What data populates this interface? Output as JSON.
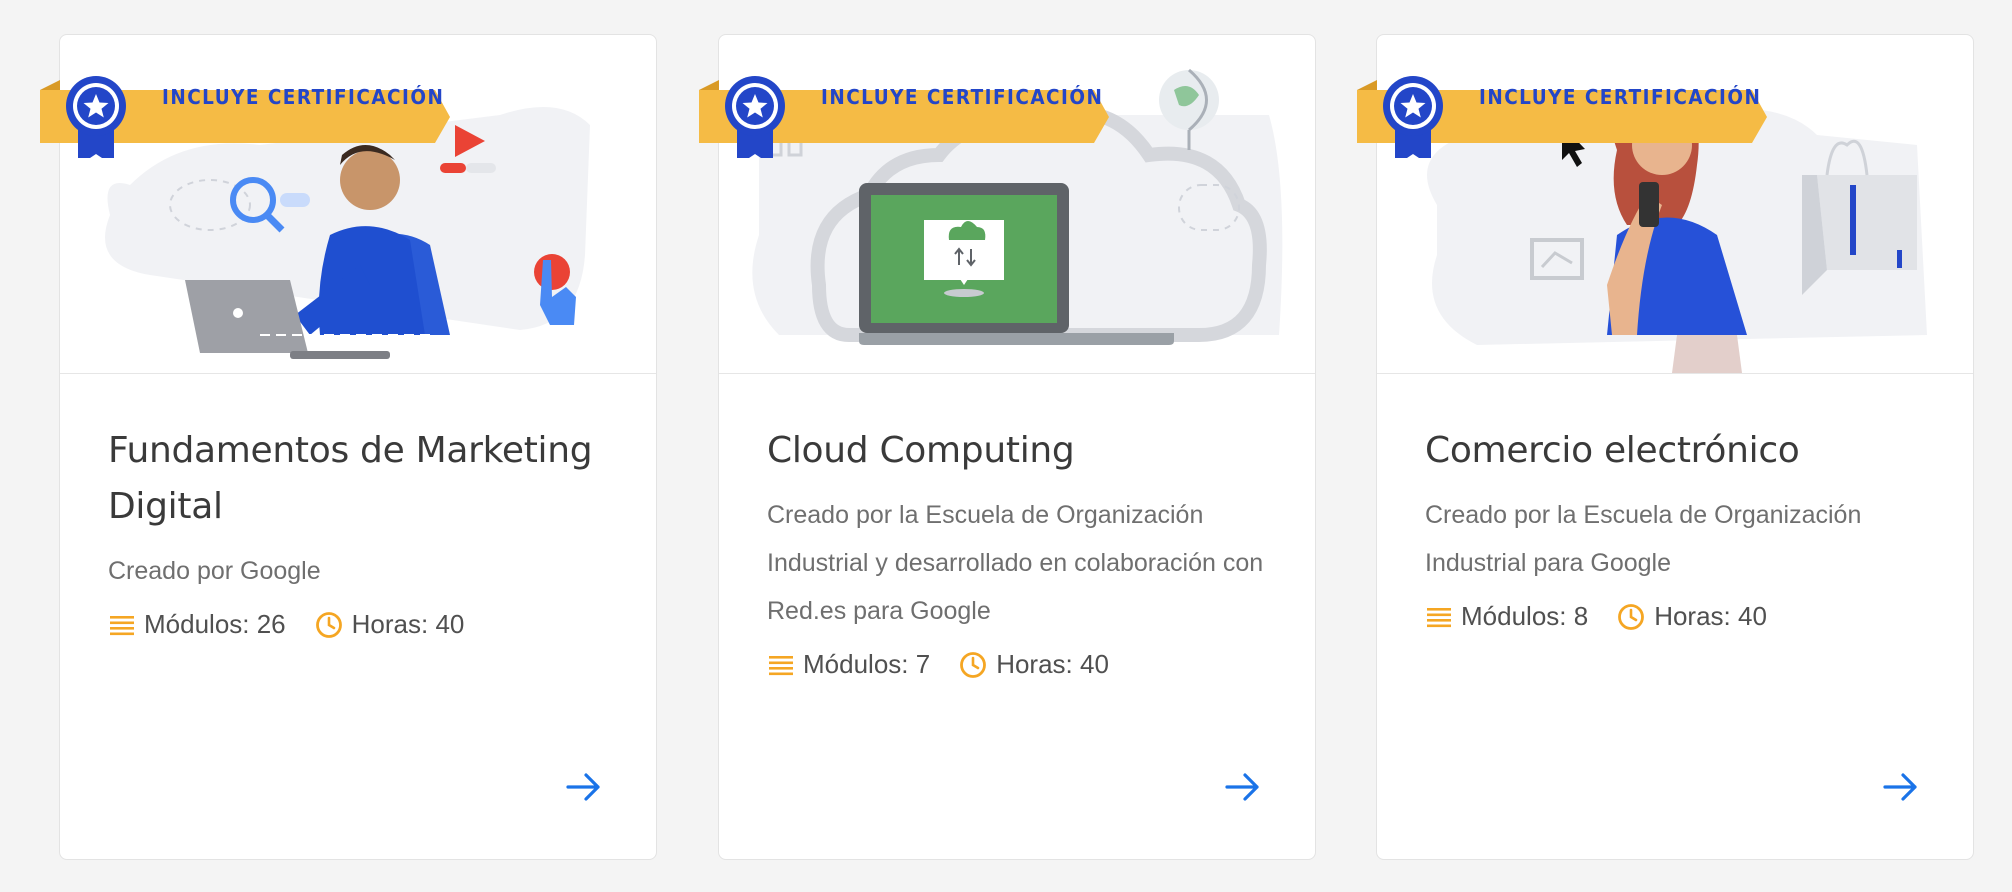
{
  "colors": {
    "badge": "#f5bb45",
    "badge_text": "#2346c8",
    "accent": "#1a73e8",
    "icon_meta": "#f5a623"
  },
  "cards": [
    {
      "badge": "INCLUYE CERTIFICACIÓN",
      "title": "Fundamentos de Marketing Digital",
      "subtitle": "Creado por Google",
      "modules_label": "Módulos: 26",
      "hours_label": "Horas: 40",
      "illustration": "person-laptop-marketing"
    },
    {
      "badge": "INCLUYE CERTIFICACIÓN",
      "title": "Cloud Computing",
      "subtitle": "Creado por la Escuela de Organización Industrial y desarrollado en colaboración con Red.es para Google",
      "modules_label": "Módulos: 7",
      "hours_label": "Horas: 40",
      "illustration": "laptop-cloud"
    },
    {
      "badge": "INCLUYE CERTIFICACIÓN",
      "title": "Comercio electrónico",
      "subtitle": "Creado por la Escuela de Organización Industrial para Google",
      "modules_label": "Módulos: 8",
      "hours_label": "Horas: 40",
      "illustration": "woman-phone-shopping"
    }
  ]
}
